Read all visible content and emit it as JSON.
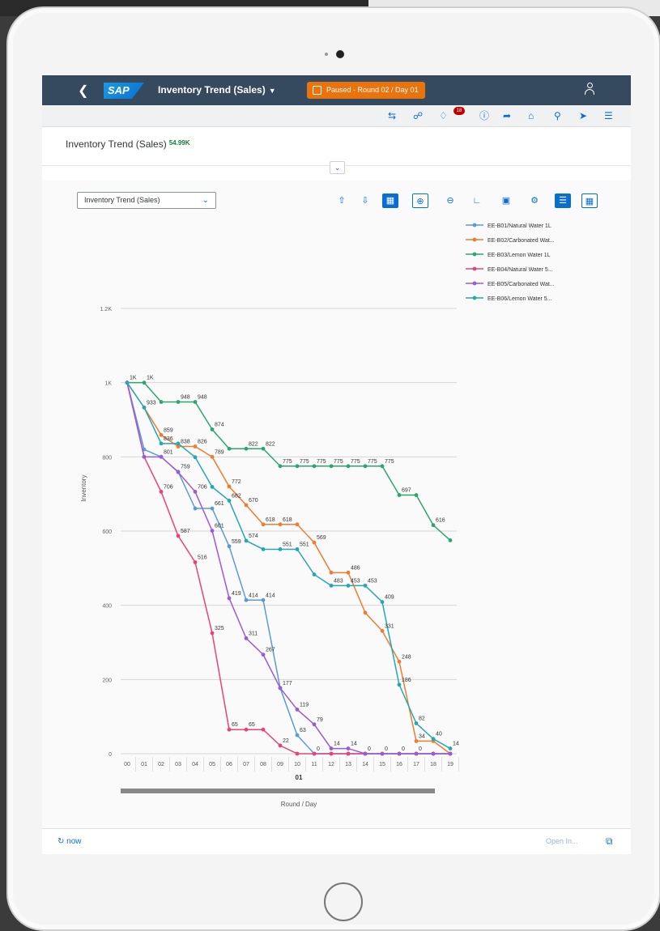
{
  "shell": {
    "back_icon": "chevron-left-icon",
    "logo_text": "SAP",
    "app_title": "Inventory Trend (Sales)",
    "status": "Paused - Round 02 / Day 01",
    "status_color": "#e9730c",
    "user_icon": "user-icon"
  },
  "toolbar": {
    "icons": [
      "transfer-icon",
      "chat-icon",
      "bell-icon",
      "help-icon",
      "share-icon",
      "home-icon",
      "search-settings-icon",
      "megaphone-icon",
      "menu-icon"
    ],
    "notification_count": "18"
  },
  "header": {
    "title": "Inventory Trend (Sales)",
    "kpi": "54.99K",
    "kpi_color": "#107e3e"
  },
  "chart_toolbar": {
    "view_select": "Inventory Trend (Sales)",
    "tools": [
      "pin-up-icon",
      "pin-down-icon",
      "chart-view-icon",
      "zoom-in-icon",
      "zoom-out-icon",
      "chart-type-icon",
      "fullscreen-icon",
      "settings-icon",
      "legend-icon",
      "table-icon"
    ]
  },
  "chart_data": {
    "type": "line",
    "ylabel": "Inventory",
    "xlabel": "Round / Day",
    "x_group_label": "01",
    "ylim": [
      0,
      1200
    ],
    "y_ticks": [
      0,
      200,
      400,
      600,
      800,
      1000,
      1200
    ],
    "y_tick_labels": [
      "0",
      "200",
      "400",
      "600",
      "800",
      "1K",
      "1.2K"
    ],
    "categories": [
      "00",
      "01",
      "02",
      "03",
      "04",
      "05",
      "06",
      "07",
      "08",
      "09",
      "10",
      "11",
      "12",
      "13",
      "14",
      "15",
      "16",
      "17",
      "18",
      "19"
    ],
    "grid": true,
    "legend_placement": "top-right",
    "series": [
      {
        "name": "EE-B01/Natural Water 1L",
        "color": "#5b9bd5",
        "values": [
          1000,
          820,
          800,
          760,
          661,
          661,
          559,
          414,
          414,
          177,
          50,
          0,
          0,
          0,
          0,
          0,
          0,
          0,
          0,
          0
        ]
      },
      {
        "name": "EE-B02/Carbonated Wat...",
        "color": "#ed7d31",
        "values": [
          1000,
          933,
          859,
          828,
          828,
          800,
          720,
          670,
          618,
          618,
          618,
          569,
          488,
          488,
          380,
          331,
          248,
          34,
          34,
          0
        ]
      },
      {
        "name": "EE-B03/Lemon Water 1L",
        "color": "#2ca66e",
        "values": [
          1000,
          1000,
          948,
          948,
          948,
          874,
          822,
          822,
          822,
          775,
          775,
          775,
          775,
          775,
          775,
          775,
          697,
          697,
          616,
          575
        ]
      },
      {
        "name": "EE-B04/Natural Water 5...",
        "color": "#e8427c",
        "values": [
          1000,
          800,
          706,
          587,
          516,
          325,
          65,
          65,
          65,
          22,
          0,
          0,
          0,
          0,
          0,
          0,
          0,
          0,
          0,
          0
        ]
      },
      {
        "name": "EE-B05/Carbonated Wat...",
        "color": "#9c5bd6",
        "values": [
          1000,
          800,
          800,
          759,
          706,
          601,
          419,
          311,
          267,
          177,
          119,
          79,
          14,
          14,
          0,
          0,
          0,
          0,
          0,
          0
        ]
      },
      {
        "name": "EE-B06/Lemon Water 5...",
        "color": "#27a6b4",
        "values": [
          1000,
          933,
          836,
          836,
          799,
          719,
          682,
          574,
          551,
          551,
          551,
          483,
          453,
          453,
          453,
          409,
          186,
          82,
          40,
          14
        ]
      }
    ],
    "point_labels": [
      {
        "series": 0,
        "i": 2,
        "text": "801"
      },
      {
        "series": 0,
        "i": 3,
        "text": "759"
      },
      {
        "series": 0,
        "i": 5,
        "text": "661"
      },
      {
        "series": 0,
        "i": 6,
        "text": "559"
      },
      {
        "series": 0,
        "i": 7,
        "text": "414"
      },
      {
        "series": 0,
        "i": 8,
        "text": "414"
      },
      {
        "series": 0,
        "i": 10,
        "text": "63"
      },
      {
        "series": 0,
        "i": 11,
        "text": "0"
      },
      {
        "series": 1,
        "i": 1,
        "text": "933"
      },
      {
        "series": 1,
        "i": 2,
        "text": "859"
      },
      {
        "series": 1,
        "i": 3,
        "text": "838"
      },
      {
        "series": 1,
        "i": 4,
        "text": "826"
      },
      {
        "series": 1,
        "i": 5,
        "text": "789"
      },
      {
        "series": 1,
        "i": 6,
        "text": "772"
      },
      {
        "series": 1,
        "i": 7,
        "text": "670"
      },
      {
        "series": 1,
        "i": 8,
        "text": "618"
      },
      {
        "series": 1,
        "i": 9,
        "text": "618"
      },
      {
        "series": 1,
        "i": 11,
        "text": "569"
      },
      {
        "series": 1,
        "i": 13,
        "text": "486"
      },
      {
        "series": 1,
        "i": 15,
        "text": "331"
      },
      {
        "series": 1,
        "i": 16,
        "text": "248"
      },
      {
        "series": 1,
        "i": 17,
        "text": "34"
      },
      {
        "series": 2,
        "i": 0,
        "text": "1K"
      },
      {
        "series": 2,
        "i": 1,
        "text": "1K"
      },
      {
        "series": 2,
        "i": 3,
        "text": "948"
      },
      {
        "series": 2,
        "i": 4,
        "text": "948"
      },
      {
        "series": 2,
        "i": 5,
        "text": "874"
      },
      {
        "series": 2,
        "i": 7,
        "text": "822"
      },
      {
        "series": 2,
        "i": 8,
        "text": "822"
      },
      {
        "series": 2,
        "i": 9,
        "text": "775"
      },
      {
        "series": 2,
        "i": 10,
        "text": "775"
      },
      {
        "series": 2,
        "i": 11,
        "text": "775"
      },
      {
        "series": 2,
        "i": 12,
        "text": "775"
      },
      {
        "series": 2,
        "i": 13,
        "text": "775"
      },
      {
        "series": 2,
        "i": 14,
        "text": "775"
      },
      {
        "series": 2,
        "i": 15,
        "text": "775"
      },
      {
        "series": 2,
        "i": 16,
        "text": "697"
      },
      {
        "series": 2,
        "i": 18,
        "text": "616"
      },
      {
        "series": 3,
        "i": 2,
        "text": "706"
      },
      {
        "series": 3,
        "i": 3,
        "text": "587"
      },
      {
        "series": 3,
        "i": 4,
        "text": "516"
      },
      {
        "series": 3,
        "i": 5,
        "text": "325"
      },
      {
        "series": 3,
        "i": 6,
        "text": "65"
      },
      {
        "series": 3,
        "i": 7,
        "text": "65"
      },
      {
        "series": 3,
        "i": 9,
        "text": "22"
      },
      {
        "series": 4,
        "i": 4,
        "text": "706"
      },
      {
        "series": 4,
        "i": 5,
        "text": "601"
      },
      {
        "series": 4,
        "i": 6,
        "text": "419"
      },
      {
        "series": 4,
        "i": 7,
        "text": "311"
      },
      {
        "series": 4,
        "i": 8,
        "text": "267"
      },
      {
        "series": 4,
        "i": 9,
        "text": "177"
      },
      {
        "series": 4,
        "i": 10,
        "text": "119"
      },
      {
        "series": 4,
        "i": 11,
        "text": "79"
      },
      {
        "series": 4,
        "i": 12,
        "text": "14"
      },
      {
        "series": 4,
        "i": 13,
        "text": "14"
      },
      {
        "series": 4,
        "i": 14,
        "text": "0"
      },
      {
        "series": 4,
        "i": 15,
        "text": "0"
      },
      {
        "series": 4,
        "i": 16,
        "text": "0"
      },
      {
        "series": 4,
        "i": 17,
        "text": "0"
      },
      {
        "series": 5,
        "i": 2,
        "text": "836"
      },
      {
        "series": 5,
        "i": 6,
        "text": "682"
      },
      {
        "series": 5,
        "i": 7,
        "text": "574"
      },
      {
        "series": 5,
        "i": 9,
        "text": "551"
      },
      {
        "series": 5,
        "i": 10,
        "text": "551"
      },
      {
        "series": 5,
        "i": 12,
        "text": "483"
      },
      {
        "series": 5,
        "i": 13,
        "text": "453"
      },
      {
        "series": 5,
        "i": 14,
        "text": "453"
      },
      {
        "series": 5,
        "i": 15,
        "text": "409"
      },
      {
        "series": 5,
        "i": 16,
        "text": "186"
      },
      {
        "series": 5,
        "i": 17,
        "text": "82"
      },
      {
        "series": 5,
        "i": 18,
        "text": "40"
      },
      {
        "series": 5,
        "i": 19,
        "text": "14"
      }
    ]
  },
  "footer": {
    "refresh_label": "now",
    "open_in_label": "Open In...",
    "export_icon": "export-icon"
  }
}
